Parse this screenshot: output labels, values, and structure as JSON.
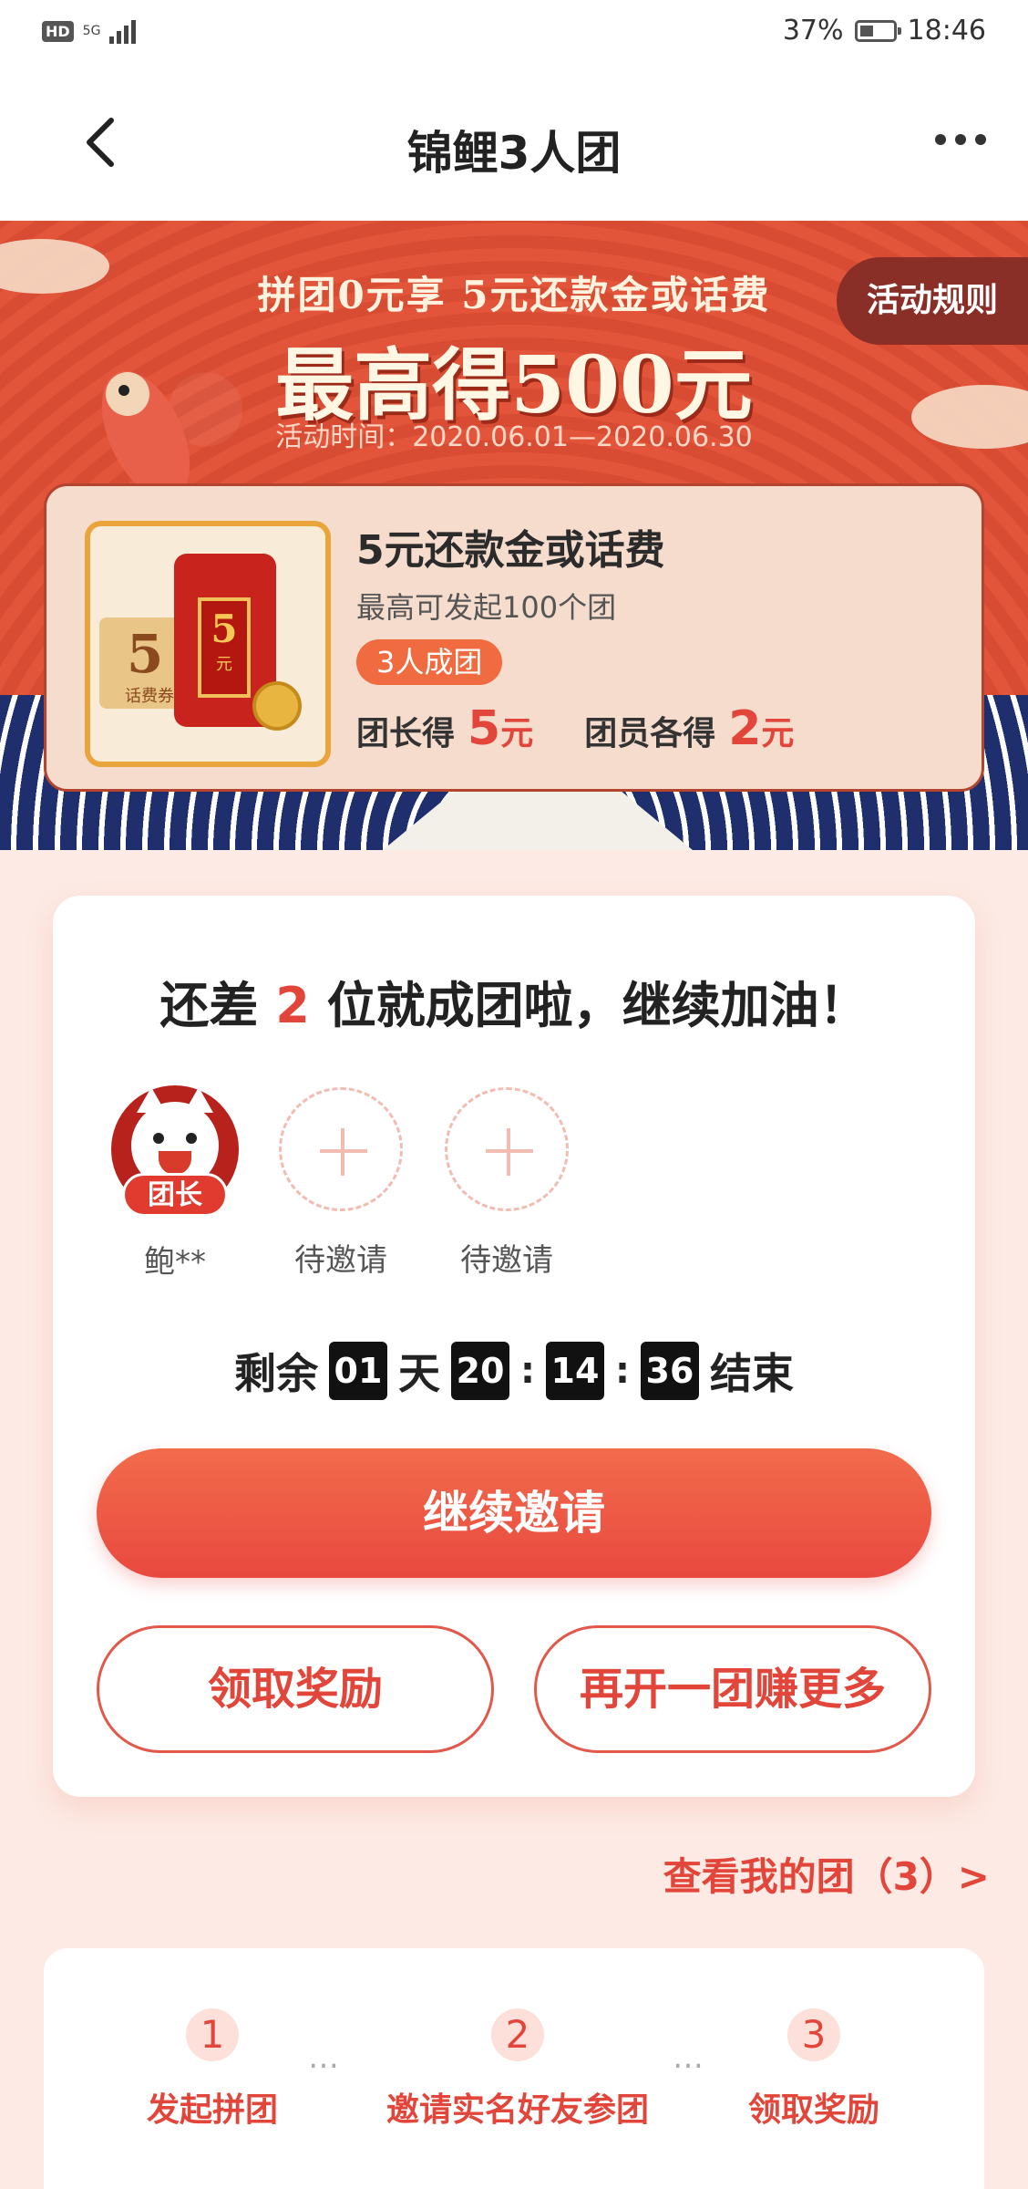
{
  "status_bar": {
    "hd": "HD",
    "network": "5G",
    "battery": "37%",
    "time": "18:46"
  },
  "nav": {
    "title": "锦鲤3人团"
  },
  "banner": {
    "subtitle": "拼团0元享 5元还款金或话费",
    "headline": "最高得500元",
    "date": "活动时间：2020.06.01—2020.06.30",
    "rules_button": "活动规则"
  },
  "prize": {
    "ticket_value": "5",
    "ticket_label": "话费券",
    "packet_value": "5",
    "packet_unit": "元",
    "title": "5元还款金或话费",
    "desc": "最高可发起100个团",
    "tag": "3人成团",
    "leader_label": "团长得",
    "leader_amount": "5",
    "leader_unit": "元",
    "member_label": "团员各得",
    "member_amount": "2",
    "member_unit": "元"
  },
  "group": {
    "title_prefix": "还差",
    "remaining": "2",
    "title_suffix": "位就成团啦，继续加油！",
    "members": [
      {
        "name": "鲍**",
        "badge": "团长"
      },
      {
        "name": "待邀请"
      },
      {
        "name": "待邀请"
      }
    ],
    "countdown": {
      "prefix": "剩余",
      "days": "01",
      "day_unit": "天",
      "hours": "20",
      "minutes": "14",
      "seconds": "36",
      "suffix": "结束"
    },
    "invite_button": "继续邀请",
    "claim_button": "领取奖励",
    "new_group_button": "再开一团赚更多"
  },
  "my_groups_link": "查看我的团（3）>",
  "steps": [
    {
      "num": "1",
      "label": "发起拼团"
    },
    {
      "num": "2",
      "label": "邀请实名好友参团"
    },
    {
      "num": "3",
      "label": "领取奖励"
    }
  ],
  "colors": {
    "accent": "#e2463a",
    "banner_red": "#d84c33",
    "page_bg": "#fdeae4"
  }
}
